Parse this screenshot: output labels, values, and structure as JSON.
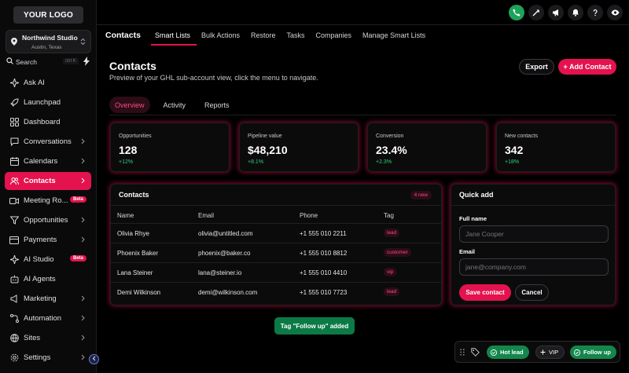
{
  "sidebar": {
    "logo": "YOUR LOGO",
    "account": {
      "name": "Northwind Studio",
      "location": "Austin, Texas"
    },
    "search": {
      "label": "Search",
      "shortcut": "ctrl K"
    },
    "items": [
      {
        "label": "Ask AI"
      },
      {
        "label": "Launchpad"
      },
      {
        "label": "Dashboard"
      },
      {
        "label": "Conversations"
      },
      {
        "label": "Calendars"
      },
      {
        "label": "Contacts"
      },
      {
        "label": "Meeting Ro...",
        "badge": "Beta"
      },
      {
        "label": "Opportunities"
      },
      {
        "label": "Payments"
      },
      {
        "label": "AI Studio",
        "badge": "Beta"
      },
      {
        "label": "AI Agents"
      },
      {
        "label": "Marketing"
      },
      {
        "label": "Automation"
      },
      {
        "label": "Sites"
      },
      {
        "label": "Settings"
      }
    ]
  },
  "topnav": {
    "title": "Contacts",
    "tabs": [
      "Smart Lists",
      "Bulk Actions",
      "Restore",
      "Tasks",
      "Companies",
      "Manage Smart Lists"
    ]
  },
  "header": {
    "title": "Contacts",
    "subtitle": "Preview of your GHL sub-account view, click the menu to navigate.",
    "export_label": "Export",
    "add_label": "+ Add Contact"
  },
  "subtabs": [
    "Overview",
    "Activity",
    "Reports"
  ],
  "stats": [
    {
      "label": "Opportunities",
      "value": "128",
      "delta": "+12%"
    },
    {
      "label": "Pipeline value",
      "value": "$48,210",
      "delta": "+8.1%"
    },
    {
      "label": "Conversion",
      "value": "23.4%",
      "delta": "+2.3%"
    },
    {
      "label": "New contacts",
      "value": "342",
      "delta": "+18%"
    }
  ],
  "contacts": {
    "title": "Contacts",
    "badge": "4 new",
    "columns": [
      "Name",
      "Email",
      "Phone",
      "Tag"
    ],
    "rows": [
      {
        "name": "Olivia Rhye",
        "email": "olivia@untitled.com",
        "phone": "+1 555 010 2211",
        "tag": "lead"
      },
      {
        "name": "Phoenix Baker",
        "email": "phoenix@baker.co",
        "phone": "+1 555 010 8812",
        "tag": "customer"
      },
      {
        "name": "Lana Steiner",
        "email": "lana@steiner.io",
        "phone": "+1 555 010 4410",
        "tag": "vip"
      },
      {
        "name": "Demi Wilkinson",
        "email": "demi@wilkinson.com",
        "phone": "+1 555 010 7723",
        "tag": "lead"
      }
    ]
  },
  "quick_add": {
    "title": "Quick add",
    "name_label": "Full name",
    "name_placeholder": "Jane Cooper",
    "email_label": "Email",
    "email_placeholder": "jane@company.com",
    "save_label": "Save contact",
    "cancel_label": "Cancel"
  },
  "toast": "Tag \"Follow up\" added",
  "tag_bar": {
    "chips": [
      "Hot lead",
      "VIP",
      "Follow up"
    ]
  },
  "colors": {
    "accent": "#e4124e",
    "success": "#1ea35a",
    "background": "#000000"
  },
  "icons": {
    "top": [
      "phone-icon",
      "magic-wand-icon",
      "megaphone-icon",
      "bell-icon",
      "help-icon",
      "eye-icon"
    ]
  }
}
